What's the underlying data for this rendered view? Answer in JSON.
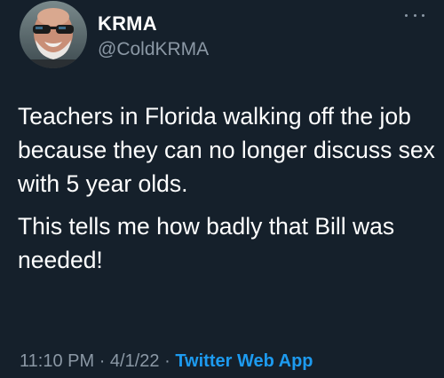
{
  "author": {
    "display_name": "KRMA",
    "handle": "@ColdKRMA"
  },
  "icons": {
    "more": "more-horizontal-icon"
  },
  "tweet": {
    "paragraph_1": "Teachers in Florida walking off the job because they can no longer discuss sex with 5 year olds.",
    "paragraph_2": "This tells me how badly that Bill was needed!"
  },
  "meta": {
    "time": "11:10 PM",
    "separator": "·",
    "date": "4/1/22",
    "app": "Twitter Web App"
  },
  "colors": {
    "background": "#15202b",
    "text": "#ffffff",
    "secondary": "#8b98a5",
    "link": "#1d9bf0"
  }
}
